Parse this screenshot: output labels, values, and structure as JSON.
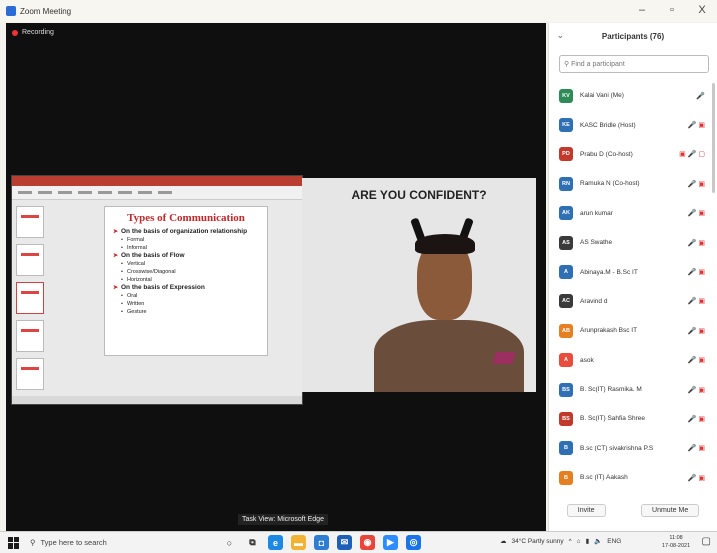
{
  "window": {
    "title": "Zoom Meeting",
    "minimize": "–",
    "maximize": "▫",
    "close": "X"
  },
  "meeting": {
    "recording_label": "Recording"
  },
  "slide": {
    "title": "Types of Communication",
    "items": [
      {
        "text": "On the basis of organization relationship",
        "level": "head"
      },
      {
        "text": "Formal",
        "level": "sub"
      },
      {
        "text": "Informal",
        "level": "sub"
      },
      {
        "text": "On the basis of Flow",
        "level": "head"
      },
      {
        "text": "Vertical",
        "level": "sub"
      },
      {
        "text": "Crosswise/Diagonal",
        "level": "sub"
      },
      {
        "text": "Horizontal",
        "level": "sub"
      },
      {
        "text": "On the basis of Expression",
        "level": "head"
      },
      {
        "text": "Oral",
        "level": "sub"
      },
      {
        "text": "Written",
        "level": "sub"
      },
      {
        "text": "Gesture",
        "level": "sub"
      }
    ]
  },
  "video": {
    "caption": "ARE YOU CONFIDENT?"
  },
  "participants": {
    "title": "Participants (76)",
    "search_placeholder": "Find a participant",
    "list": [
      {
        "initials": "KV",
        "name": "Kalai Vani (Me)",
        "color": "#2e8b57",
        "icons": "🎤"
      },
      {
        "initials": "KE",
        "name": "KASC Bridle (Host)",
        "color": "#2f6fb3",
        "icons": "🎤 ▣"
      },
      {
        "initials": "PD",
        "name": "Prabu D (Co-host)",
        "color": "#c0392b",
        "icons": "▣ 🎤 ▢"
      },
      {
        "initials": "RN",
        "name": "Ramuka N (Co-host)",
        "color": "#2f6fb3",
        "icons": "🎤 ▣"
      },
      {
        "initials": "AK",
        "name": "arun kumar",
        "color": "#2f6fb3",
        "icons": "🎤 ▣"
      },
      {
        "initials": "AS",
        "name": "AS Swathe",
        "color": "#3a3a3a",
        "icons": "🎤 ▣"
      },
      {
        "initials": "A",
        "name": "Abinaya.M - B.Sc IT",
        "color": "#2f6fb3",
        "icons": "🎤 ▣"
      },
      {
        "initials": "AC",
        "name": "Aravind d",
        "color": "#3a3a3a",
        "icons": "🎤 ▣"
      },
      {
        "initials": "AB",
        "name": "Arunprakash Bsc IT",
        "color": "#e67e22",
        "icons": "🎤 ▣"
      },
      {
        "initials": "A",
        "name": "asok",
        "color": "#e74c3c",
        "icons": "🎤 ▣"
      },
      {
        "initials": "BS",
        "name": "B. Sc(IT) Rasmika. M",
        "color": "#2f6fb3",
        "icons": "🎤 ▣"
      },
      {
        "initials": "BS",
        "name": "B. Sc(IT) Sahfia Shree",
        "color": "#c0392b",
        "icons": "🎤 ▣"
      },
      {
        "initials": "B",
        "name": "B.sc (CT) sivakrishna P.S",
        "color": "#2f6fb3",
        "icons": "🎤 ▣"
      },
      {
        "initials": "B",
        "name": "B.sc (IT) Aakash",
        "color": "#e67e22",
        "icons": "🎤 ▣"
      }
    ],
    "invite_label": "Invite",
    "unmute_label": "Unmute Me"
  },
  "tooltip": "Task View: Microsoft Edge",
  "taskbar": {
    "search_placeholder": "Type here to search",
    "weather": "34°C  Partly sunny",
    "lang": "ENG",
    "time": "11:08",
    "date": "17-08-2021"
  }
}
